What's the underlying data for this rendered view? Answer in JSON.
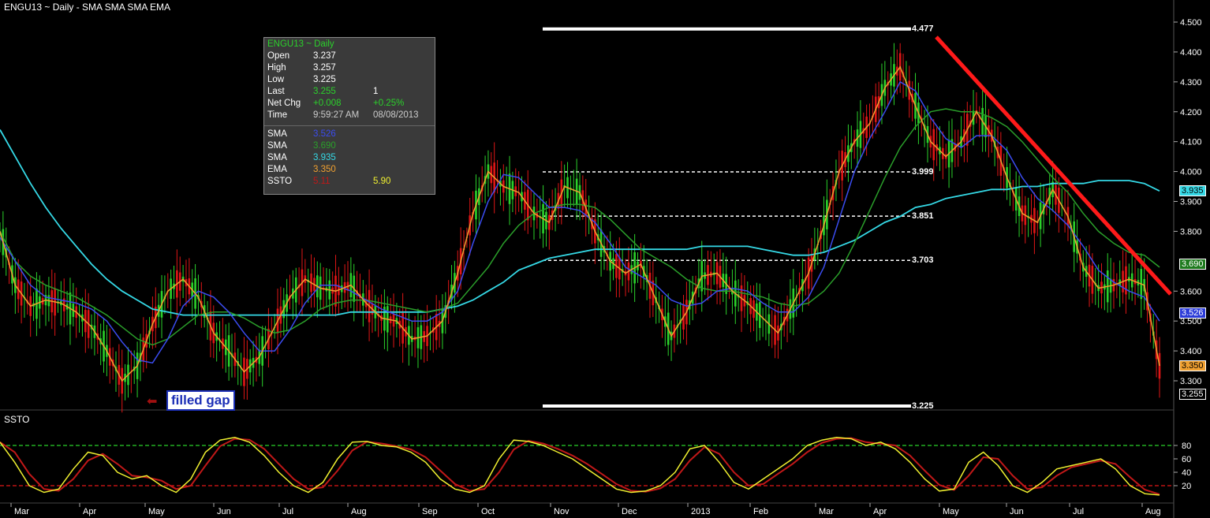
{
  "header": {
    "title": "ENGU13 ~ Daily  -  SMA SMA SMA EMA"
  },
  "info_box": {
    "title": "ENGU13 ~ Daily",
    "rows": [
      {
        "label": "Open",
        "v1": "3.237",
        "v2": "",
        "c1": "#ffffff"
      },
      {
        "label": "High",
        "v1": "3.257",
        "v2": "",
        "c1": "#ffffff"
      },
      {
        "label": "Low",
        "v1": "3.225",
        "v2": "",
        "c1": "#ffffff"
      },
      {
        "label": "Last",
        "v1": "3.255",
        "v2": "1",
        "c1": "#2bd12b"
      },
      {
        "label": "Net Chg",
        "v1": "+0.008",
        "v2": "+0.25%",
        "c1": "#2bd12b",
        "c2": "#2bd12b"
      },
      {
        "label": "Time",
        "v1": "9:59:27 AM",
        "v2": "08/08/2013",
        "c1": "#cccccc",
        "c2": "#cccccc"
      }
    ],
    "indicators": [
      {
        "label": "SMA",
        "v1": "3.526",
        "v2": "",
        "c1": "#3b4cf0"
      },
      {
        "label": "SMA",
        "v1": "3.690",
        "v2": "",
        "c1": "#2aa02a"
      },
      {
        "label": "SMA",
        "v1": "3.935",
        "v2": "",
        "c1": "#35d9e6"
      },
      {
        "label": "EMA",
        "v1": "3.350",
        "v2": "",
        "c1": "#f0a030"
      },
      {
        "label": "SSTO",
        "v1": "5.11",
        "v2": "5.90",
        "c1": "#c01818",
        "c2": "#f0f030"
      }
    ]
  },
  "annotation": {
    "text": "filled gap",
    "arrow": "⬅"
  },
  "ssto_label": "SSTO",
  "price_tags": [
    {
      "text": "3.935",
      "value": 3.935,
      "bg": "#35d9e6",
      "fg": "#000000"
    },
    {
      "text": "3.690",
      "value": 3.69,
      "bg": "#1e7a1e",
      "fg": "#ffffff"
    },
    {
      "text": "3.526",
      "value": 3.526,
      "bg": "#2b3bd8",
      "fg": "#ffffff"
    },
    {
      "text": "3.350",
      "value": 3.35,
      "bg": "#f0a030",
      "fg": "#000000"
    },
    {
      "text": "3.255",
      "value": 3.255,
      "bg": "#000000",
      "fg": "#ffffff"
    }
  ],
  "colors": {
    "up": "#2bd12b",
    "down": "#e01616",
    "sma_fast": "#3b4cf0",
    "sma_mid": "#2a9e2a",
    "sma_slow": "#35d9e6",
    "ema": "#f0a030",
    "trend": "#ff1a1a",
    "ssto_k": "#f0f030",
    "ssto_d": "#c01818"
  },
  "chart_data": {
    "type": "line",
    "price_axis": {
      "ticks": [
        "4.500",
        "4.400",
        "4.300",
        "4.200",
        "4.100",
        "4.000",
        "3.900",
        "3.800",
        "3.600",
        "3.500",
        "3.400",
        "3.300"
      ],
      "ylim": [
        3.2,
        4.5
      ]
    },
    "x_tick_labels": [
      "Mar",
      "Apr",
      "May",
      "Jun",
      "Jul",
      "Aug",
      "Sep",
      "Oct",
      "Nov",
      "Dec",
      "2013",
      "Feb",
      "Mar",
      "Apr",
      "May",
      "Jun",
      "Jul",
      "Aug"
    ],
    "levels": [
      {
        "label": "4.477",
        "value": 4.477,
        "style": "solid"
      },
      {
        "label": "3.999",
        "value": 3.999,
        "style": "dashed"
      },
      {
        "label": "3.851",
        "value": 3.851,
        "style": "dashed"
      },
      {
        "label": "3.703",
        "value": 3.703,
        "style": "dashed"
      },
      {
        "label": "3.225",
        "value": 3.225,
        "style": "solid"
      }
    ],
    "ema": [
      3.8,
      3.62,
      3.55,
      3.57,
      3.56,
      3.53,
      3.48,
      3.4,
      3.3,
      3.35,
      3.49,
      3.6,
      3.64,
      3.58,
      3.46,
      3.4,
      3.33,
      3.38,
      3.48,
      3.58,
      3.64,
      3.61,
      3.6,
      3.62,
      3.56,
      3.51,
      3.5,
      3.44,
      3.45,
      3.5,
      3.66,
      3.86,
      4.0,
      3.95,
      3.93,
      3.86,
      3.83,
      3.95,
      3.93,
      3.8,
      3.7,
      3.66,
      3.69,
      3.57,
      3.45,
      3.53,
      3.65,
      3.66,
      3.6,
      3.56,
      3.51,
      3.46,
      3.56,
      3.66,
      3.82,
      4.0,
      4.1,
      4.16,
      4.28,
      4.35,
      4.22,
      4.1,
      4.05,
      4.1,
      4.2,
      4.12,
      3.98,
      3.86,
      3.83,
      3.94,
      3.85,
      3.68,
      3.61,
      3.62,
      3.64,
      3.62,
      3.35
    ],
    "sma_fast": [
      3.78,
      3.7,
      3.62,
      3.58,
      3.57,
      3.56,
      3.54,
      3.5,
      3.43,
      3.37,
      3.36,
      3.44,
      3.55,
      3.6,
      3.58,
      3.53,
      3.46,
      3.4,
      3.4,
      3.47,
      3.56,
      3.62,
      3.62,
      3.6,
      3.57,
      3.54,
      3.52,
      3.5,
      3.5,
      3.53,
      3.6,
      3.76,
      3.9,
      3.99,
      3.98,
      3.93,
      3.88,
      3.88,
      3.87,
      3.83,
      3.76,
      3.68,
      3.65,
      3.62,
      3.57,
      3.55,
      3.56,
      3.6,
      3.61,
      3.6,
      3.56,
      3.53,
      3.53,
      3.58,
      3.68,
      3.84,
      4.0,
      4.11,
      4.2,
      4.3,
      4.27,
      4.18,
      4.11,
      4.08,
      4.12,
      4.12,
      4.07,
      3.98,
      3.91,
      3.87,
      3.82,
      3.75,
      3.67,
      3.63,
      3.6,
      3.58,
      3.5
    ],
    "sma_mid": [
      3.8,
      3.7,
      3.65,
      3.62,
      3.6,
      3.58,
      3.55,
      3.52,
      3.48,
      3.44,
      3.42,
      3.44,
      3.48,
      3.52,
      3.53,
      3.53,
      3.51,
      3.48,
      3.46,
      3.47,
      3.5,
      3.54,
      3.56,
      3.57,
      3.57,
      3.56,
      3.55,
      3.54,
      3.53,
      3.54,
      3.56,
      3.62,
      3.68,
      3.76,
      3.82,
      3.86,
      3.88,
      3.89,
      3.89,
      3.88,
      3.84,
      3.79,
      3.74,
      3.71,
      3.68,
      3.64,
      3.61,
      3.6,
      3.6,
      3.59,
      3.58,
      3.56,
      3.55,
      3.56,
      3.6,
      3.66,
      3.76,
      3.87,
      3.98,
      4.08,
      4.15,
      4.2,
      4.21,
      4.2,
      4.2,
      4.18,
      4.15,
      4.1,
      4.04,
      3.98,
      3.93,
      3.86,
      3.8,
      3.76,
      3.73,
      3.72,
      3.68
    ],
    "sma_slow": [
      4.14,
      4.05,
      3.96,
      3.88,
      3.81,
      3.75,
      3.69,
      3.64,
      3.6,
      3.57,
      3.54,
      3.53,
      3.52,
      3.52,
      3.52,
      3.52,
      3.52,
      3.52,
      3.52,
      3.52,
      3.52,
      3.52,
      3.52,
      3.53,
      3.53,
      3.53,
      3.53,
      3.53,
      3.53,
      3.54,
      3.55,
      3.57,
      3.6,
      3.63,
      3.67,
      3.69,
      3.71,
      3.72,
      3.73,
      3.74,
      3.74,
      3.74,
      3.74,
      3.74,
      3.74,
      3.74,
      3.75,
      3.75,
      3.75,
      3.75,
      3.74,
      3.73,
      3.72,
      3.72,
      3.73,
      3.75,
      3.77,
      3.8,
      3.83,
      3.85,
      3.88,
      3.89,
      3.91,
      3.92,
      3.93,
      3.94,
      3.94,
      3.95,
      3.95,
      3.96,
      3.96,
      3.96,
      3.97,
      3.97,
      3.97,
      3.96,
      3.935
    ],
    "trendline": [
      [
        1187,
        4.45
      ],
      [
        1484,
        3.59
      ]
    ],
    "ssto_axis": {
      "ticks": [
        "80",
        "60",
        "40",
        "20"
      ],
      "ylim": [
        0,
        100
      ],
      "upper": 80,
      "lower": 20
    },
    "ssto": [
      85,
      55,
      20,
      10,
      15,
      45,
      70,
      65,
      40,
      30,
      35,
      20,
      10,
      30,
      70,
      88,
      92,
      85,
      65,
      40,
      20,
      10,
      25,
      60,
      85,
      86,
      80,
      78,
      70,
      55,
      30,
      15,
      10,
      20,
      60,
      88,
      86,
      80,
      70,
      60,
      45,
      30,
      15,
      10,
      12,
      20,
      40,
      75,
      80,
      55,
      25,
      15,
      30,
      45,
      60,
      80,
      88,
      92,
      90,
      80,
      85,
      75,
      55,
      30,
      12,
      15,
      55,
      70,
      50,
      20,
      10,
      25,
      45,
      50,
      55,
      60,
      45,
      20,
      8,
      6
    ]
  }
}
